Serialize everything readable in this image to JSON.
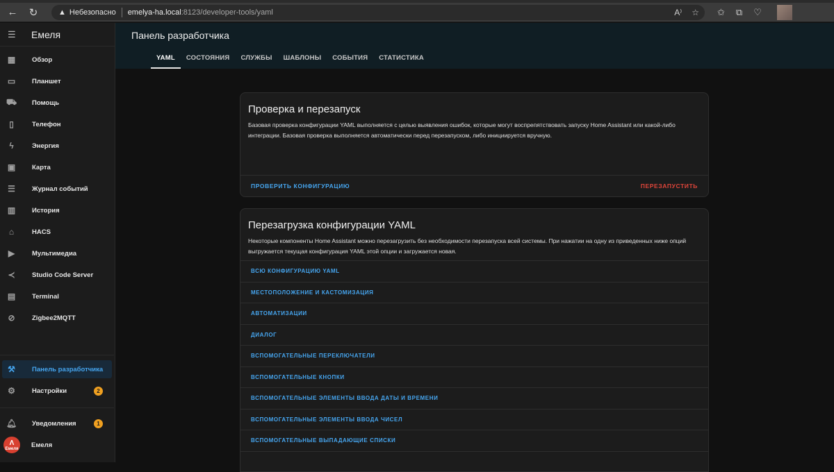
{
  "browser": {
    "back_icon": "arrow-left-icon",
    "reload_icon": "reload-icon",
    "insecure_label": "Небезопасно",
    "url_host": "emelya-ha.local",
    "url_path": ":8123/developer-tools/yaml"
  },
  "sidebar": {
    "title": "Емеля",
    "items": [
      {
        "label": "Обзор",
        "icon": "dashboard-icon"
      },
      {
        "label": "Планшет",
        "icon": "tablet-icon"
      },
      {
        "label": "Помощь",
        "icon": "car-icon"
      },
      {
        "label": "Телефон",
        "icon": "phone-icon"
      },
      {
        "label": "Энергия",
        "icon": "lightning-icon"
      },
      {
        "label": "Карта",
        "icon": "map-icon"
      },
      {
        "label": "Журнал событий",
        "icon": "list-icon"
      },
      {
        "label": "История",
        "icon": "chart-icon"
      },
      {
        "label": "HACS",
        "icon": "hacs-icon"
      },
      {
        "label": "Мультимедиа",
        "icon": "media-icon"
      },
      {
        "label": "Studio Code Server",
        "icon": "vscode-icon"
      },
      {
        "label": "Terminal",
        "icon": "terminal-icon"
      },
      {
        "label": "Zigbee2MQTT",
        "icon": "zigbee-icon"
      }
    ],
    "developer_label": "Панель разработчика",
    "settings_label": "Настройки",
    "settings_badge": "2",
    "notifications_label": "Уведомления",
    "notifications_badge": "1",
    "user_label": "Емеля",
    "user_avatar_text": "Емеля"
  },
  "header": {
    "title": "Панель разработчика",
    "tabs": [
      "YAML",
      "СОСТОЯНИЯ",
      "СЛУЖБЫ",
      "ШАБЛОНЫ",
      "СОБЫТИЯ",
      "СТАТИСТИКА"
    ]
  },
  "check_card": {
    "title": "Проверка и перезапуск",
    "description": "Базовая проверка конфигурации YAML выполняется с целью выявления ошибок, которые могут воспрепятствовать запуску Home Assistant или какой-либо интеграции. Базовая проверка выполняется автоматически перед перезапуском, либо инициируется вручную.",
    "check_button": "ПРОВЕРИТЬ КОНФИГУРАЦИЮ",
    "restart_button": "ПЕРЕЗАПУСТИТЬ"
  },
  "reload_card": {
    "title": "Перезагрузка конфигурации YAML",
    "description": "Некоторые компоненты Home Assistant можно перезагрузить без необходимости перезапуска всей системы. При нажатии на одну из приведенных ниже опций выгружается текущая конфигурация YAML этой опции и загружается новая.",
    "items": [
      "ВСЮ КОНФИГУРАЦИЮ YAML",
      "МЕСТОПОЛОЖЕНИЕ И КАСТОМИЗАЦИЯ",
      "АВТОМАТИЗАЦИИ",
      "ДИАЛОГ",
      "ВСПОМОГАТЕЛЬНЫЕ ПЕРЕКЛЮЧАТЕЛИ",
      "ВСПОМОГАТЕЛЬНЫЕ КНОПКИ",
      "ВСПОМОГАТЕЛЬНЫЕ ЭЛЕМЕНТЫ ВВОДА ДАТЫ И ВРЕМЕНИ",
      "ВСПОМОГАТЕЛЬНЫЕ ЭЛЕМЕНТЫ ВВОДА ЧИСЕЛ",
      "ВСПОМОГАТЕЛЬНЫЕ ВЫПАДАЮЩИЕ СПИСКИ"
    ]
  },
  "colors": {
    "accent": "#46a6f0",
    "danger": "#e0453a",
    "badge": "#f0a020"
  }
}
